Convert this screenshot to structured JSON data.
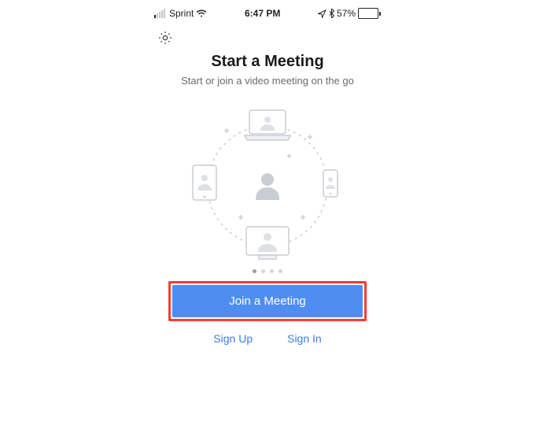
{
  "status_bar": {
    "carrier": "Sprint",
    "time": "6:47 PM",
    "battery_pct": "57%"
  },
  "hero": {
    "title": "Start a Meeting",
    "subtitle": "Start or join a video meeting on the go"
  },
  "pager": {
    "count": 4,
    "active": 0
  },
  "actions": {
    "primary": "Join a Meeting",
    "sign_up": "Sign Up",
    "sign_in": "Sign In"
  }
}
